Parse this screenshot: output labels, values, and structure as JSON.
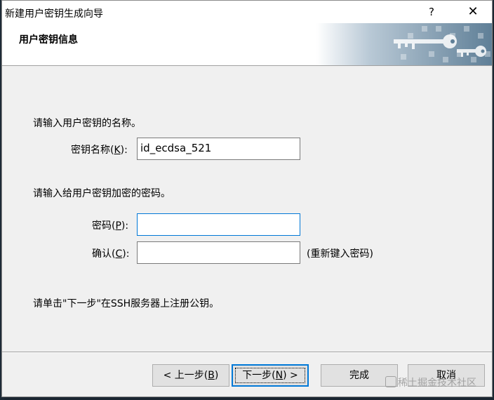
{
  "window": {
    "title": "新建用户密钥生成向导",
    "help_glyph": "?",
    "close_glyph": "✕"
  },
  "header": {
    "title": "用户密钥信息",
    "art_icon": "key-icon"
  },
  "form": {
    "key_name_prompt": "请输入用户密钥的名称。",
    "key_name_label_prefix": "密钥名称(",
    "key_name_label_accel": "K",
    "key_name_label_suffix": "):",
    "key_name_value": "id_ecdsa_521",
    "passphrase_prompt": "请输入给用户密钥加密的密码。",
    "password_label_prefix": "密码(",
    "password_label_accel": "P",
    "password_label_suffix": "):",
    "password_value": "",
    "confirm_label_prefix": "确认(",
    "confirm_label_accel": "C",
    "confirm_label_suffix": "):",
    "confirm_value": "",
    "confirm_hint": "(重新键入密码)",
    "register_note": "请单击\"下一步\"在SSH服务器上注册公钥。"
  },
  "buttons": {
    "back_prefix": "< 上一步(",
    "back_accel": "B",
    "back_suffix": ")",
    "next_prefix": "下一步(",
    "next_accel": "N",
    "next_suffix": ") >",
    "finish": "完成",
    "cancel": "取消"
  },
  "watermark": {
    "text": "稀土掘金技术社区"
  },
  "colors": {
    "focus_blue": "#0078d7",
    "dialog_bg": "#f0f0f0"
  }
}
